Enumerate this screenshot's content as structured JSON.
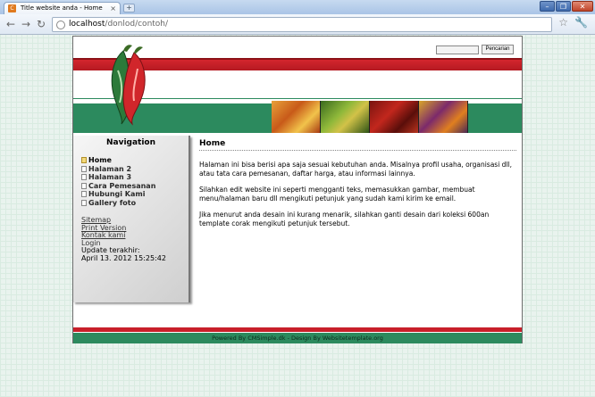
{
  "browser": {
    "tab_title": "Title website anda - Home",
    "url_host": "localhost",
    "url_path": "/donlod/contoh/"
  },
  "header": {
    "search_button": "Pencarian",
    "search_value": ""
  },
  "sidebar": {
    "title": "Navigation",
    "items": [
      {
        "label": "Home",
        "active": true
      },
      {
        "label": "Halaman 2",
        "active": false
      },
      {
        "label": "Halaman 3",
        "active": false
      },
      {
        "label": "Cara Pemesanan",
        "active": false
      },
      {
        "label": "Hubungi Kami",
        "active": false
      },
      {
        "label": "Gallery foto",
        "active": false
      }
    ],
    "links": [
      "Sitemap",
      "Print Version",
      "Kontak kami",
      "Login"
    ],
    "update_label": "Update terakhir:",
    "update_time": "April 13. 2012 15:25:42"
  },
  "content": {
    "title": "Home",
    "paragraphs": [
      "Halaman ini bisa berisi apa saja sesuai kebutuhan anda. Misalnya profil usaha, organisasi dll, atau tata cara pemesanan, daftar harga, atau informasi lainnya.",
      "Silahkan edit website ini seperti mengganti teks, memasukkan gambar, membuat menu/halaman baru dll mengikuti petunjuk yang sudah kami kirim ke email.",
      "Jika menurut anda desain ini kurang menarik, silahkan ganti desain dari koleksi 600an template corak mengikuti petunjuk tersebut."
    ]
  },
  "footer": {
    "text": "Powered By CMSimple.dk - Design By Websitetemplate.org"
  },
  "colors": {
    "red": "#c8202a",
    "green": "#2c8a5e"
  }
}
